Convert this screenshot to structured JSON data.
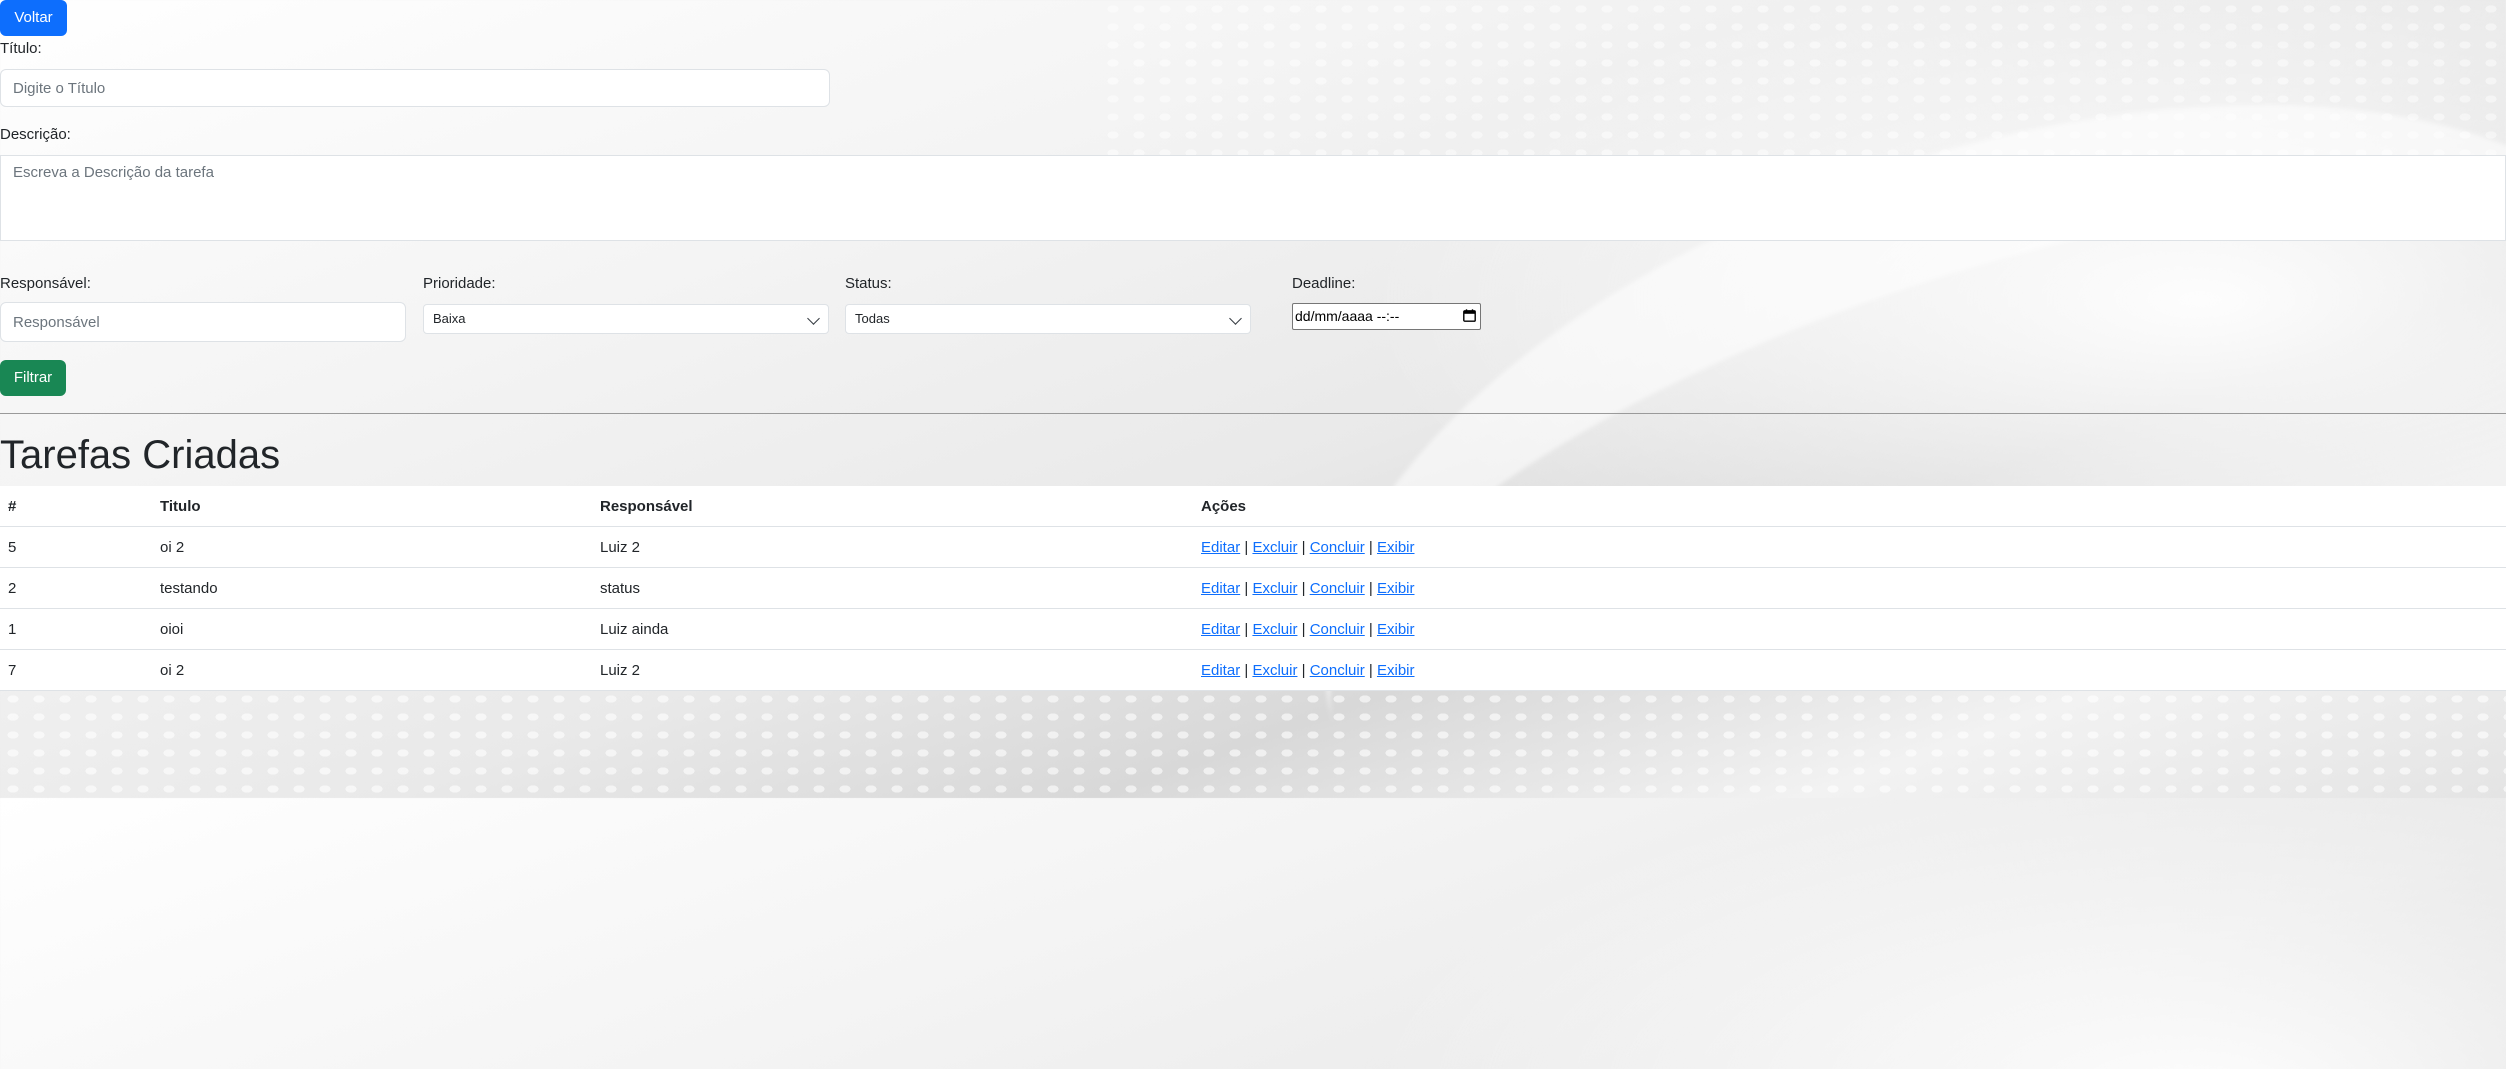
{
  "buttons": {
    "back": "Voltar",
    "filter": "Filtrar"
  },
  "form": {
    "title_label": "Título:",
    "title_placeholder": "Digite o Título",
    "description_label": "Descrição:",
    "description_placeholder": "Escreva a Descrição da tarefa",
    "responsible_label": "Responsável:",
    "responsible_placeholder": "Responsável",
    "priority_label": "Prioridade:",
    "priority_value": "Baixa",
    "status_label": "Status:",
    "status_value": "Todas",
    "deadline_label": "Deadline:",
    "deadline_value": "dd/mm/aaaa --:--"
  },
  "section_title": "Tarefas Criadas",
  "table": {
    "headers": [
      "#",
      "Titulo",
      "Responsável",
      "Ações"
    ],
    "rows": [
      {
        "id": "5",
        "title": "oi 2",
        "responsible": "Luiz 2"
      },
      {
        "id": "2",
        "title": "testando",
        "responsible": "status"
      },
      {
        "id": "1",
        "title": "oioi",
        "responsible": "Luiz ainda"
      },
      {
        "id": "7",
        "title": "oi 2",
        "responsible": "Luiz 2"
      }
    ],
    "actions": {
      "edit": "Editar",
      "delete": "Excluir",
      "complete": "Concluir",
      "show": "Exibir",
      "separator": "|"
    }
  },
  "colors": {
    "primary": "#0d6efd",
    "success": "#198754",
    "link": "#0d6efd"
  }
}
